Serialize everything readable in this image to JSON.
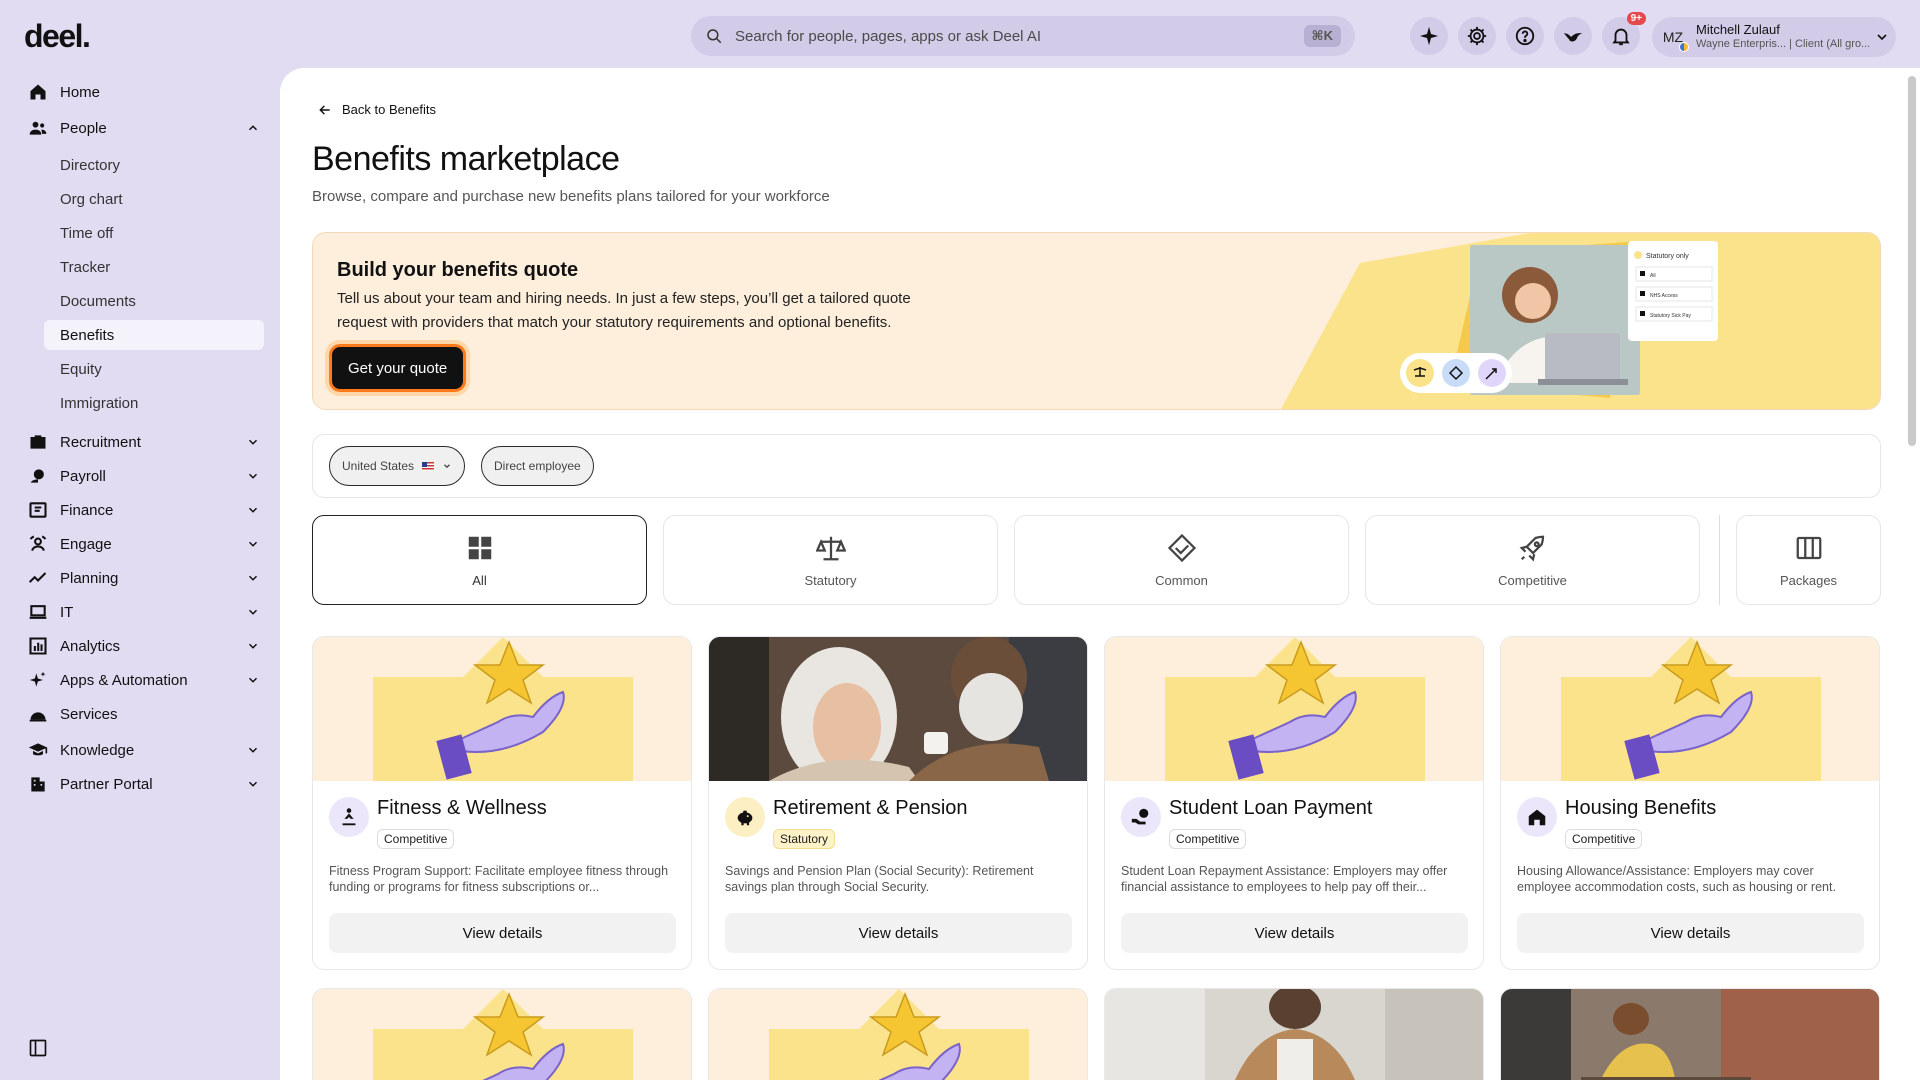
{
  "brand": {
    "logo": "deel."
  },
  "search": {
    "placeholder": "Search for people, pages, apps or ask Deel AI",
    "shortcut": "⌘K"
  },
  "header": {
    "notifications_badge": "9+",
    "user": {
      "initials": "MZ",
      "name": "Mitchell Zulauf",
      "subtitle": "Wayne Enterpris... | Client (All gro..."
    }
  },
  "sidebar": {
    "items": [
      {
        "label": "Home",
        "icon": "home-icon"
      },
      {
        "label": "People",
        "icon": "people-icon",
        "expanded": true
      },
      {
        "label": "Recruitment",
        "icon": "briefcase-icon"
      },
      {
        "label": "Payroll",
        "icon": "payroll-icon"
      },
      {
        "label": "Finance",
        "icon": "finance-icon"
      },
      {
        "label": "Engage",
        "icon": "engage-icon"
      },
      {
        "label": "Planning",
        "icon": "planning-icon"
      },
      {
        "label": "IT",
        "icon": "laptop-icon"
      },
      {
        "label": "Analytics",
        "icon": "analytics-icon"
      },
      {
        "label": "Apps & Automation",
        "icon": "sparkle-icon"
      },
      {
        "label": "Services",
        "icon": "services-icon"
      },
      {
        "label": "Knowledge",
        "icon": "graduation-cap-icon"
      },
      {
        "label": "Partner Portal",
        "icon": "building-icon"
      }
    ],
    "people_sub": [
      "Directory",
      "Org chart",
      "Time off",
      "Tracker",
      "Documents",
      "Benefits",
      "Equity",
      "Immigration"
    ],
    "active_sub": "Benefits"
  },
  "main": {
    "back_label": "Back to Benefits",
    "title": "Benefits marketplace",
    "subtitle": "Browse, compare and purchase new benefits plans tailored for your workforce",
    "banner": {
      "title": "Build your benefits quote",
      "text": "Tell us about your team and hiring needs. In just a few steps, you’ll get a tailored quote request with providers that match your statutory requirements and optional benefits.",
      "button": "Get your quote",
      "mock_panel": {
        "title": "Statutory only",
        "rows": [
          "All",
          "NHS Access",
          "Statutory Sick Pay"
        ]
      }
    },
    "filters": {
      "country": "United States",
      "employment_type": "Direct employee"
    },
    "tabs": [
      "All",
      "Statutory",
      "Common",
      "Competitive",
      "Packages"
    ],
    "active_tab": "All",
    "cards": [
      {
        "title": "Fitness & Wellness",
        "badge": "Competitive",
        "desc": "Fitness Program Support: Facilitate employee fitness through funding or programs for fitness subscriptions or...",
        "button": "View details"
      },
      {
        "title": "Retirement & Pension",
        "badge": "Statutory",
        "desc": "Savings and Pension Plan (Social Security): Retirement savings plan through Social Security.",
        "button": "View details"
      },
      {
        "title": "Student Loan Payment",
        "badge": "Competitive",
        "desc": "Student Loan Repayment Assistance: Employers may offer financial assistance to employees to help pay off their...",
        "button": "View details"
      },
      {
        "title": "Housing Benefits",
        "badge": "Competitive",
        "desc": "Housing Allowance/Assistance: Employers may cover employee accommodation costs, such as housing or rent.",
        "button": "View details"
      }
    ]
  },
  "colors": {
    "background": "#e2dcf3",
    "banner_bg": "#fdefdc",
    "accent_orange": "#ff7a1a",
    "card_yellow": "#fbe38c",
    "lavender": "#b9a6ee"
  }
}
